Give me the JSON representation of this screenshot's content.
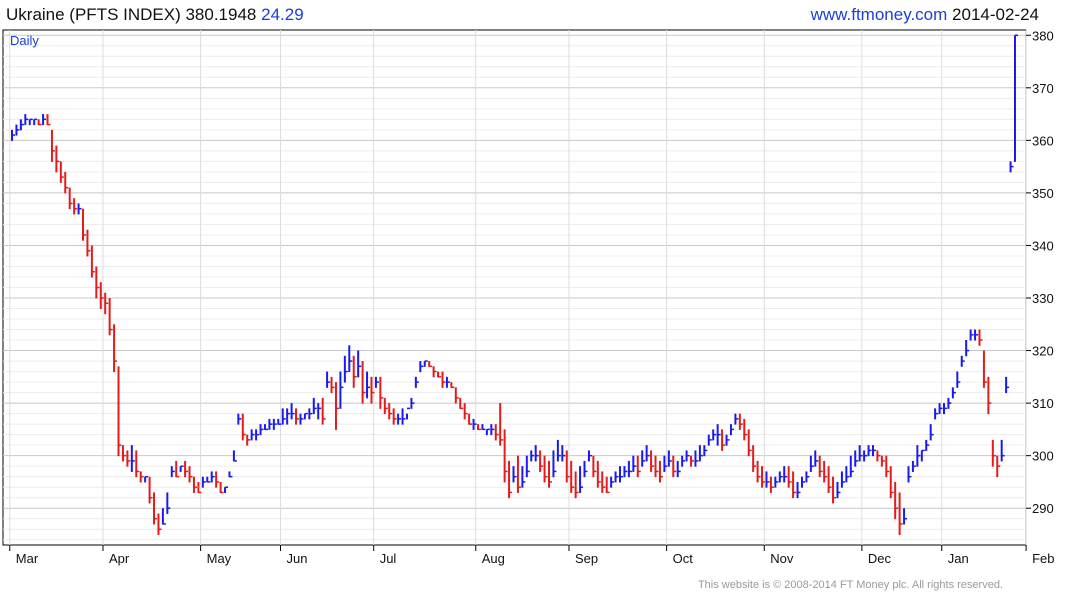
{
  "header": {
    "title": "Ukraine (PFTS INDEX) 380.1948",
    "change": "24.29",
    "site": "www.ftmoney.com",
    "date": "2014-02-24"
  },
  "footer": {
    "copyright": "This website is © 2008-2014 FT Money plc. All rights reserved."
  },
  "colors": {
    "up": "#1a1aee",
    "down": "#e31b1b",
    "grid": "#c8c8c8",
    "axis": "#000000",
    "label_blue": "#1a3fd6"
  },
  "chart_data": {
    "type": "line",
    "title": "Ukraine (PFTS INDEX) 380.1948",
    "frequency_label": "Daily",
    "xlabel": "",
    "ylabel": "",
    "x_tick_labels": [
      "Mar",
      "Apr",
      "May",
      "Jun",
      "Jul",
      "Aug",
      "Sep",
      "Oct",
      "Nov",
      "Dec",
      "Jan",
      "Feb"
    ],
    "y_ticks": [
      290,
      300,
      310,
      320,
      330,
      340,
      350,
      360,
      370,
      380
    ],
    "ylim": [
      283,
      381
    ],
    "grid": true,
    "y_axis_side": "right",
    "series": [
      {
        "values": [
          [
            362,
            361,
            360
          ],
          [
            363,
            362,
            361
          ],
          [
            364,
            363,
            362
          ],
          [
            365,
            364,
            363
          ],
          [
            364,
            364,
            363
          ],
          [
            364,
            364,
            363
          ],
          [
            364,
            363,
            363
          ],
          [
            365,
            364,
            363
          ],
          [
            365,
            363,
            363
          ],
          [
            362,
            358,
            356
          ],
          [
            359,
            356,
            354
          ],
          [
            356,
            353,
            352
          ],
          [
            354,
            351,
            350
          ],
          [
            351,
            348,
            347
          ],
          [
            349,
            347,
            346
          ],
          [
            348,
            347,
            346
          ],
          [
            347,
            342,
            341
          ],
          [
            343,
            339,
            338
          ],
          [
            340,
            335,
            334
          ],
          [
            336,
            332,
            330
          ],
          [
            333,
            330,
            328
          ],
          [
            331,
            329,
            327
          ],
          [
            330,
            324,
            323
          ],
          [
            325,
            318,
            316
          ],
          [
            317,
            302,
            300
          ],
          [
            302,
            300,
            299
          ],
          [
            301,
            299,
            298
          ],
          [
            302,
            299,
            297
          ],
          [
            301,
            297,
            296
          ],
          [
            297,
            296,
            295
          ],
          [
            296,
            296,
            295
          ],
          [
            296,
            292,
            291
          ],
          [
            293,
            288,
            287
          ],
          [
            289,
            286,
            285
          ],
          [
            290,
            287,
            287
          ],
          [
            293,
            290,
            289
          ],
          [
            298,
            297,
            296
          ],
          [
            299,
            296,
            296
          ],
          [
            298,
            298,
            297
          ],
          [
            299,
            297,
            296
          ],
          [
            298,
            296,
            295
          ],
          [
            296,
            294,
            293
          ],
          [
            295,
            293,
            293
          ],
          [
            296,
            295,
            294
          ],
          [
            296,
            295,
            295
          ],
          [
            297,
            296,
            295
          ],
          [
            297,
            295,
            294
          ],
          [
            295,
            293,
            293
          ],
          [
            294,
            294,
            293
          ],
          [
            297,
            296,
            296
          ],
          [
            301,
            299,
            299
          ],
          [
            308,
            307,
            306
          ],
          [
            308,
            304,
            303
          ],
          [
            304,
            303,
            302
          ],
          [
            305,
            304,
            303
          ],
          [
            305,
            304,
            303
          ],
          [
            306,
            305,
            304
          ],
          [
            306,
            305,
            305
          ],
          [
            307,
            306,
            305
          ],
          [
            307,
            306,
            305
          ],
          [
            307,
            306,
            306
          ],
          [
            309,
            307,
            306
          ],
          [
            309,
            308,
            306
          ],
          [
            310,
            308,
            307
          ],
          [
            309,
            307,
            306
          ],
          [
            308,
            307,
            306
          ],
          [
            308,
            308,
            307
          ],
          [
            309,
            308,
            307
          ],
          [
            311,
            309,
            308
          ],
          [
            310,
            309,
            307
          ],
          [
            311,
            307,
            306
          ],
          [
            316,
            314,
            313
          ],
          [
            315,
            313,
            312
          ],
          [
            314,
            309,
            305
          ],
          [
            316,
            313,
            309
          ],
          [
            319,
            316,
            314
          ],
          [
            321,
            318,
            316
          ],
          [
            319,
            315,
            313
          ],
          [
            320,
            317,
            315
          ],
          [
            318,
            312,
            310
          ],
          [
            316,
            313,
            311
          ],
          [
            315,
            312,
            310
          ],
          [
            315,
            314,
            313
          ],
          [
            315,
            311,
            309
          ],
          [
            311,
            309,
            308
          ],
          [
            310,
            308,
            307
          ],
          [
            309,
            307,
            306
          ],
          [
            308,
            307,
            306
          ],
          [
            309,
            307,
            306
          ],
          [
            308,
            309,
            307
          ],
          [
            311,
            310,
            309
          ],
          [
            315,
            314,
            313
          ],
          [
            318,
            317,
            316
          ],
          [
            318,
            318,
            317
          ],
          [
            318,
            317,
            317
          ],
          [
            317,
            316,
            315
          ],
          [
            316,
            315,
            315
          ],
          [
            316,
            314,
            313
          ],
          [
            315,
            314,
            313
          ],
          [
            314,
            313,
            313
          ],
          [
            313,
            311,
            310
          ],
          [
            311,
            309,
            309
          ],
          [
            310,
            308,
            307
          ],
          [
            308,
            306,
            306
          ],
          [
            307,
            306,
            305
          ],
          [
            306,
            305,
            305
          ],
          [
            306,
            305,
            305
          ],
          [
            305,
            305,
            304
          ],
          [
            306,
            305,
            304
          ],
          [
            306,
            304,
            303
          ],
          [
            310,
            303,
            302
          ],
          [
            305,
            297,
            295
          ],
          [
            299,
            293,
            292
          ],
          [
            298,
            296,
            295
          ],
          [
            300,
            294,
            293
          ],
          [
            298,
            295,
            294
          ],
          [
            300,
            297,
            296
          ],
          [
            301,
            300,
            299
          ],
          [
            302,
            300,
            299
          ],
          [
            301,
            298,
            297
          ],
          [
            300,
            296,
            295
          ],
          [
            299,
            295,
            294
          ],
          [
            301,
            297,
            296
          ],
          [
            303,
            300,
            299
          ],
          [
            302,
            300,
            299
          ],
          [
            301,
            296,
            295
          ],
          [
            299,
            294,
            293
          ],
          [
            297,
            293,
            292
          ],
          [
            298,
            294,
            293
          ],
          [
            299,
            297,
            296
          ],
          [
            301,
            300,
            299
          ],
          [
            300,
            297,
            296
          ],
          [
            299,
            295,
            294
          ],
          [
            297,
            294,
            293
          ],
          [
            296,
            293,
            293
          ],
          [
            296,
            295,
            294
          ],
          [
            297,
            296,
            295
          ],
          [
            298,
            296,
            295
          ],
          [
            298,
            297,
            296
          ],
          [
            299,
            297,
            296
          ],
          [
            300,
            298,
            297
          ],
          [
            300,
            297,
            296
          ],
          [
            301,
            299,
            298
          ],
          [
            302,
            300,
            299
          ],
          [
            301,
            298,
            297
          ],
          [
            300,
            297,
            296
          ],
          [
            299,
            296,
            295
          ],
          [
            300,
            298,
            297
          ],
          [
            301,
            299,
            298
          ],
          [
            300,
            297,
            296
          ],
          [
            299,
            297,
            296
          ],
          [
            300,
            299,
            298
          ],
          [
            301,
            300,
            299
          ],
          [
            300,
            299,
            298
          ],
          [
            301,
            299,
            298
          ],
          [
            302,
            300,
            299
          ],
          [
            302,
            301,
            300
          ],
          [
            304,
            303,
            302
          ],
          [
            305,
            304,
            303
          ],
          [
            306,
            304,
            302
          ],
          [
            305,
            302,
            301
          ],
          [
            304,
            303,
            302
          ],
          [
            306,
            305,
            304
          ],
          [
            308,
            307,
            306
          ],
          [
            308,
            306,
            305
          ],
          [
            307,
            304,
            303
          ],
          [
            305,
            301,
            300
          ],
          [
            302,
            298,
            297
          ],
          [
            299,
            296,
            295
          ],
          [
            298,
            295,
            294
          ],
          [
            297,
            295,
            294
          ],
          [
            296,
            294,
            293
          ],
          [
            296,
            295,
            294
          ],
          [
            297,
            296,
            295
          ],
          [
            298,
            296,
            295
          ],
          [
            298,
            295,
            294
          ],
          [
            297,
            293,
            292
          ],
          [
            295,
            293,
            292
          ],
          [
            296,
            295,
            294
          ],
          [
            297,
            296,
            295
          ],
          [
            300,
            298,
            297
          ],
          [
            301,
            299,
            298
          ],
          [
            300,
            297,
            296
          ],
          [
            299,
            296,
            295
          ],
          [
            298,
            294,
            293
          ],
          [
            296,
            292,
            291
          ],
          [
            295,
            293,
            292
          ],
          [
            297,
            295,
            294
          ],
          [
            298,
            296,
            295
          ],
          [
            300,
            297,
            296
          ],
          [
            301,
            299,
            298
          ],
          [
            302,
            300,
            299
          ],
          [
            301,
            300,
            299
          ],
          [
            302,
            301,
            300
          ],
          [
            302,
            301,
            300
          ],
          [
            301,
            300,
            299
          ],
          [
            300,
            299,
            298
          ],
          [
            300,
            297,
            296
          ],
          [
            298,
            293,
            292
          ],
          [
            295,
            290,
            288
          ],
          [
            293,
            287,
            285
          ],
          [
            290,
            288,
            287
          ],
          [
            298,
            296,
            295
          ],
          [
            299,
            298,
            297
          ],
          [
            302,
            300,
            298
          ],
          [
            301,
            301,
            299
          ],
          [
            303,
            302,
            301
          ],
          [
            306,
            304,
            303
          ],
          [
            309,
            308,
            307
          ],
          [
            310,
            309,
            308
          ],
          [
            310,
            309,
            308
          ],
          [
            311,
            310,
            309
          ],
          [
            313,
            312,
            311
          ],
          [
            316,
            314,
            313
          ],
          [
            319,
            318,
            317
          ],
          [
            322,
            320,
            319
          ],
          [
            324,
            323,
            322
          ],
          [
            324,
            323,
            322
          ],
          [
            324,
            322,
            321
          ],
          [
            320,
            314,
            313
          ],
          [
            315,
            310,
            308
          ],
          [
            303,
            300,
            298
          ],
          [
            300,
            298,
            296
          ],
          [
            303,
            300,
            299
          ],
          [
            315,
            313,
            312
          ],
          [
            356,
            355,
            354
          ],
          [
            380,
            380,
            356
          ]
        ]
      }
    ]
  }
}
